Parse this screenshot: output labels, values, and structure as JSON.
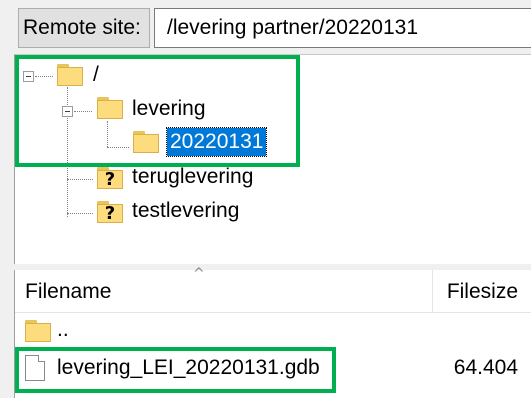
{
  "site_bar": {
    "label": "Remote site:",
    "path": "/levering partner/20220131"
  },
  "tree": {
    "items": [
      {
        "label": "/",
        "icon": "folder-icon",
        "expanded": true
      },
      {
        "label": "levering",
        "icon": "folder-icon",
        "expanded": true
      },
      {
        "label": "20220131",
        "icon": "folder-icon",
        "selected": true
      },
      {
        "label": "teruglevering",
        "icon": "unknown-folder-icon"
      },
      {
        "label": "testlevering",
        "icon": "unknown-folder-icon"
      }
    ]
  },
  "file_list": {
    "columns": {
      "filename": "Filename",
      "filesize": "Filesize"
    },
    "rows": [
      {
        "name": "..",
        "size": "",
        "icon": "folder-icon"
      },
      {
        "name": "levering_LEI_20220131.gdb",
        "size": "64.404",
        "icon": "file-icon"
      }
    ]
  },
  "colors": {
    "highlight_box": "#00b050",
    "selection": "#0078d7"
  }
}
